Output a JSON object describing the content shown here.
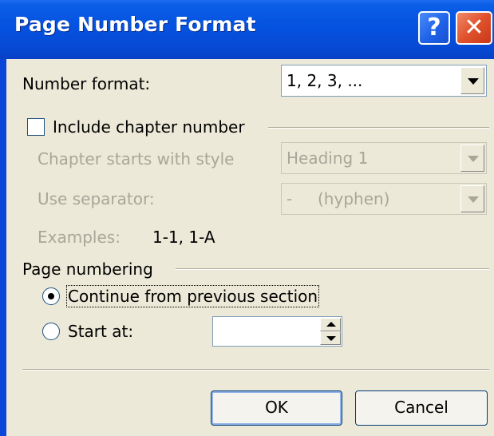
{
  "window": {
    "title": "Page Number Format",
    "help_glyph": "?",
    "close_glyph": "✕"
  },
  "number_format": {
    "label": "Number format:",
    "value": "1, 2, 3, ..."
  },
  "chapter": {
    "include_label": "Include chapter number",
    "include_checked": false,
    "starts_with_label": "Chapter starts with style",
    "starts_with_value": "Heading 1",
    "separator_label": "Use separator:",
    "separator_value": "-     (hyphen)",
    "examples_label": "Examples:",
    "examples_value": "1-1, 1-A"
  },
  "page_numbering": {
    "group_label": "Page numbering",
    "continue_label": "Continue from previous section",
    "start_at_label": "Start at:",
    "selected": "continue",
    "start_at_value": ""
  },
  "buttons": {
    "ok": "OK",
    "cancel": "Cancel"
  },
  "colors": {
    "titlebar": "#0552e0",
    "client_bg": "#ece9d8",
    "disabled_text": "#a9a69a"
  }
}
